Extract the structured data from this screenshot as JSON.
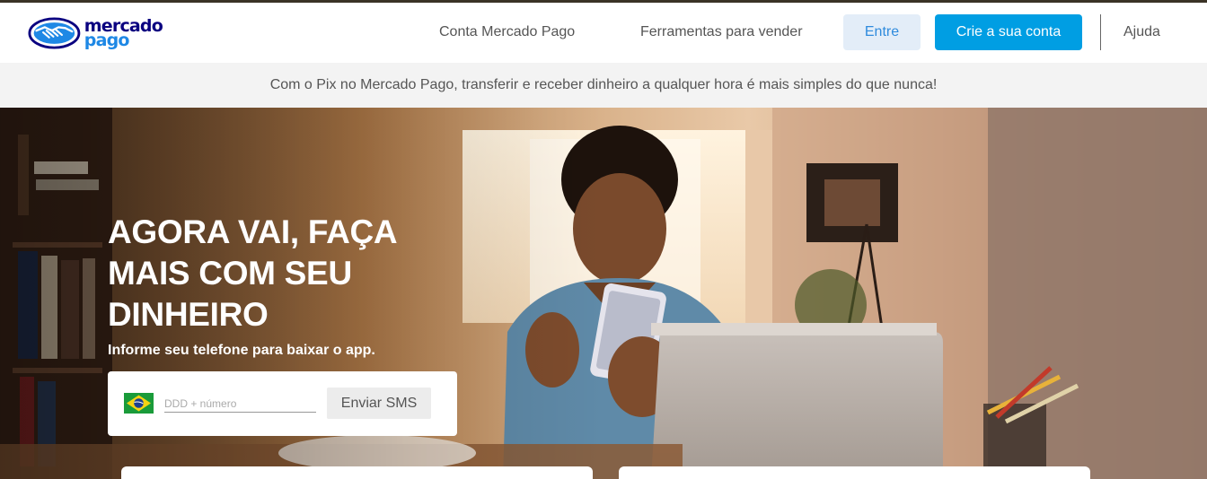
{
  "header": {
    "logo_line1": "mercado",
    "logo_line2": "pago",
    "nav": {
      "conta": "Conta Mercado Pago",
      "ferramentas": "Ferramentas para vender",
      "entre": "Entre",
      "crie": "Crie a sua conta",
      "ajuda": "Ajuda"
    }
  },
  "banner": {
    "text": "Com o Pix no Mercado Pago, transferir e receber dinheiro a qualquer hora é mais simples do que nunca!"
  },
  "hero": {
    "title_lines": [
      "AGORA VAI, FAÇA",
      "MAIS COM SEU",
      "DINHEIRO"
    ],
    "subtitle": "Informe seu telefone para baixar o app.",
    "phone_placeholder": "DDD + número",
    "sms_button": "Enviar SMS",
    "country_flag": "brazil-flag-icon"
  },
  "colors": {
    "brand_navy": "#0a0080",
    "brand_blue": "#009ee3",
    "entre_bg": "#e3edf8",
    "banner_bg": "#f3f3f3"
  }
}
